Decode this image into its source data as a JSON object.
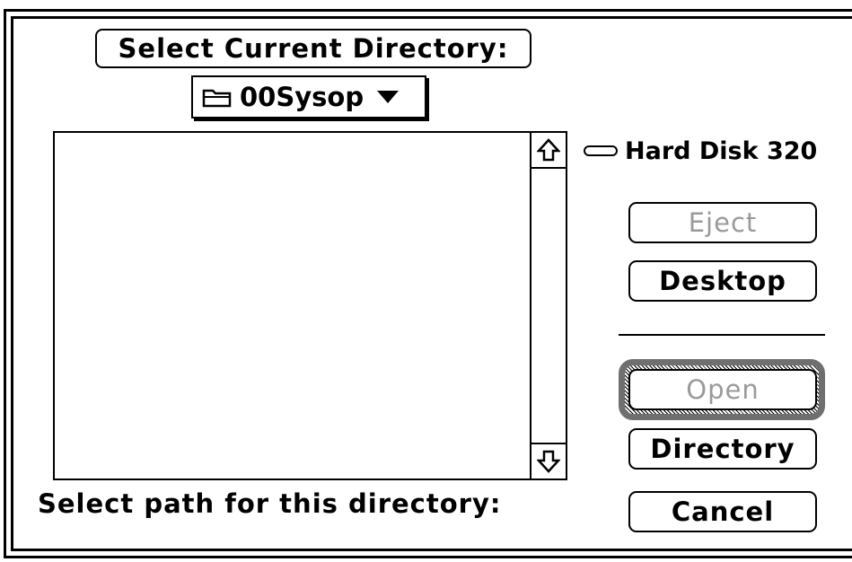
{
  "dialog": {
    "title": "Select Current Directory:",
    "popup": {
      "label": "00Sysop",
      "folder_icon": "folder-icon",
      "arrow_icon": "triangle-down-icon"
    },
    "file_list": {
      "items": []
    },
    "volume": {
      "name": "Hard Disk 320",
      "icon": "hard-disk-icon"
    },
    "buttons": {
      "eject": "Eject",
      "desktop": "Desktop",
      "open": "Open",
      "directory": "Directory",
      "cancel": "Cancel"
    },
    "prompt": "Select path for this directory:"
  }
}
